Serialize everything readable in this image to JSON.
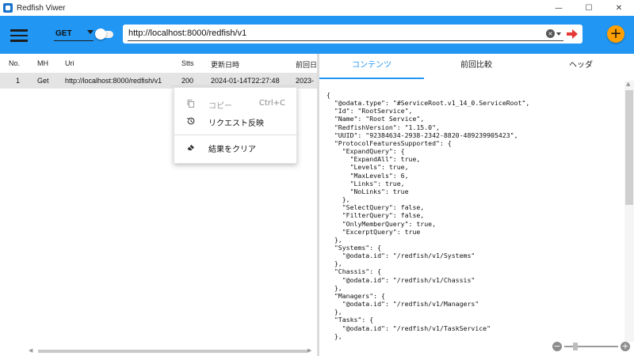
{
  "window": {
    "title": "Redfish Viwer",
    "minimize_glyph": "—",
    "maximize_glyph": "☐",
    "close_glyph": "✕"
  },
  "toolbar": {
    "menu_icon": "hamburger-menu-icon",
    "method": "GET",
    "url": "http://localhost:8000/redfish/v1",
    "clear_glyph": "×",
    "add_glyph": "+",
    "send_icon_color": "#e53935",
    "add_button_color": "#ffa000",
    "bar_color": "#2196f3"
  },
  "history_grid": {
    "columns": [
      "No.",
      "MH",
      "Uri",
      "Stts",
      "更新日時",
      "前回日"
    ],
    "rows": [
      {
        "no": "1",
        "mh": "Get",
        "uri": "http://localhost:8000/redfish/v1",
        "status": "200",
        "updated": "2024-01-14T22:27:48",
        "previous": "2023-"
      }
    ],
    "scroll_left": "◀",
    "scroll_right": "▶"
  },
  "context_menu": {
    "items": [
      {
        "label": "コピー",
        "shortcut": "Ctrl+C",
        "icon": "copy-icon",
        "disabled": true
      },
      {
        "label": "リクエスト反映",
        "shortcut": "",
        "icon": "history-icon",
        "disabled": false
      },
      {
        "label": "結果をクリア",
        "shortcut": "",
        "icon": "eraser-icon",
        "disabled": false
      }
    ]
  },
  "detail": {
    "tabs": [
      "コンテンツ",
      "前回比較",
      "ヘッダ"
    ],
    "active_tab": "コンテンツ",
    "json_text": "{\n  \"@odata.type\": \"#ServiceRoot.v1_14_0.ServiceRoot\",\n  \"Id\": \"RootService\",\n  \"Name\": \"Root Service\",\n  \"RedfishVersion\": \"1.15.0\",\n  \"UUID\": \"92384634-2938-2342-8820-489239905423\",\n  \"ProtocolFeaturesSupported\": {\n    \"ExpandQuery\": {\n      \"ExpandAll\": true,\n      \"Levels\": true,\n      \"MaxLevels\": 6,\n      \"Links\": true,\n      \"NoLinks\": true\n    },\n    \"SelectQuery\": false,\n    \"FilterQuery\": false,\n    \"OnlyMemberQuery\": true,\n    \"ExcerptQuery\": true\n  },\n  \"Systems\": {\n    \"@odata.id\": \"/redfish/v1/Systems\"\n  },\n  \"Chassis\": {\n    \"@odata.id\": \"/redfish/v1/Chassis\"\n  },\n  \"Managers\": {\n    \"@odata.id\": \"/redfish/v1/Managers\"\n  },\n  \"Tasks\": {\n    \"@odata.id\": \"/redfish/v1/TaskService\"\n  },",
    "zoom_minus": "−",
    "zoom_plus": "+",
    "scroll_up": "▲",
    "accent_color": "#2196f3"
  }
}
